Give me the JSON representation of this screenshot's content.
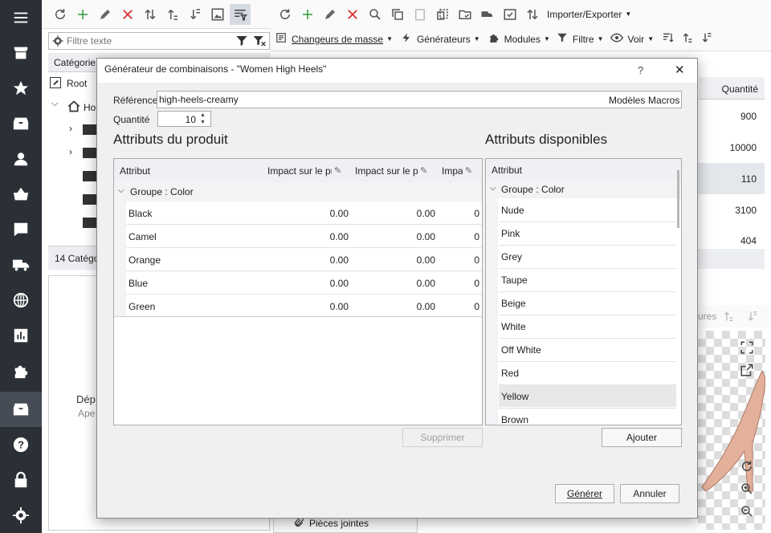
{
  "rail": {
    "icons": [
      "menu-icon",
      "store-icon",
      "star-icon",
      "inbox-icon",
      "user-icon",
      "basket-icon",
      "comment-icon",
      "truck-icon",
      "globe-icon",
      "chart-icon",
      "puzzle-icon",
      "box-icon",
      "help-icon",
      "lock-icon",
      "gear-icon"
    ]
  },
  "left_toolbar": {
    "icons": [
      "refresh-icon",
      "add-icon",
      "edit-icon",
      "delete-icon",
      "sort-icon",
      "move-up-icon",
      "move-down-icon",
      "image-edit-icon",
      "filter-list-icon"
    ]
  },
  "left_panel": {
    "filter_placeholder": "Filtre texte",
    "category_header": "Catégorie",
    "tree": [
      {
        "label": "Root"
      },
      {
        "label": "Ho"
      }
    ],
    "footer": "14 Catégo",
    "bottom_text_1": "Dép",
    "bottom_text_2": "Ape"
  },
  "main_toolbar": {
    "import_export": "Importer/Exporter",
    "mass_changers": "Changeurs de masse",
    "generators": "Générateurs",
    "modules": "Modules",
    "filter": "Filtre",
    "view": "Voir"
  },
  "main": {
    "qty_header": "Quantité",
    "qty_values": [
      "900",
      "10000",
      "110",
      "3100",
      "404"
    ],
    "side_label": "ures",
    "attachments": "Pièces jointes"
  },
  "modal": {
    "title": "Générateur de combinaisons - \"Women High Heels\"",
    "help": "?",
    "close": "✕",
    "reference_label": "Référence",
    "reference_value": "high-heels-creamy",
    "templates": "Modèles",
    "macros": "Macros",
    "quantity_label": "Quantité",
    "quantity_value": "10",
    "product_attrs_title": "Attributs du produit",
    "available_attrs_title": "Attributs disponibles",
    "left_grid": {
      "columns": [
        "Attribut",
        "Impact sur le pr",
        "Impact sur le pr",
        "Impa"
      ],
      "group": "Groupe : Color",
      "rows": [
        {
          "name": "Black",
          "v1": "0.00",
          "v2": "0.00",
          "v3": "0"
        },
        {
          "name": "Camel",
          "v1": "0.00",
          "v2": "0.00",
          "v3": "0"
        },
        {
          "name": "Orange",
          "v1": "0.00",
          "v2": "0.00",
          "v3": "0"
        },
        {
          "name": "Blue",
          "v1": "0.00",
          "v2": "0.00",
          "v3": "0"
        },
        {
          "name": "Green",
          "v1": "0.00",
          "v2": "0.00",
          "v3": "0"
        }
      ]
    },
    "right_grid": {
      "column": "Attribut",
      "group": "Groupe : Color",
      "rows": [
        "Nude",
        "Pink",
        "Grey",
        "Taupe",
        "Beige",
        "White",
        "Off White",
        "Red",
        "Yellow",
        "Brown"
      ]
    },
    "delete_button": "Supprimer",
    "add_button": "Ajouter",
    "generate_button": "Générer",
    "cancel_button": "Annuler"
  }
}
